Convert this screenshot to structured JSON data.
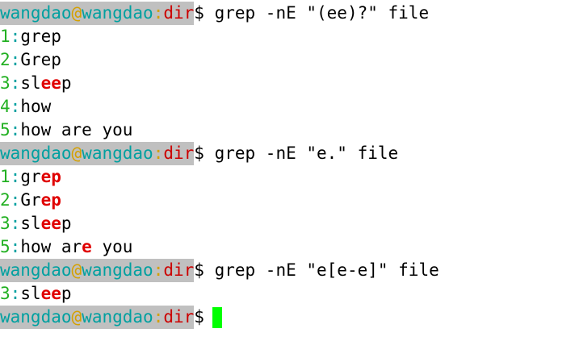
{
  "prompt": {
    "user": "wangdao",
    "at": "@",
    "host": "wangdao",
    "colon": ":",
    "dir": "dir",
    "dollar": "$"
  },
  "colors": {
    "prompt_bg": "#c0c0c0",
    "user_host": "#00a0a0",
    "at_colon": "#d4a000",
    "dir": "#cc0000",
    "line_number": "#22b022",
    "separator": "#00a0a0",
    "match": "#e00000",
    "cursor": "#00ff00"
  },
  "blocks": [
    {
      "command": " grep -nE \"(ee)?\" file",
      "results": [
        {
          "num": "1",
          "sep": ":",
          "pre": "grep",
          "match": "",
          "post": ""
        },
        {
          "num": "2",
          "sep": ":",
          "pre": "Grep",
          "match": "",
          "post": ""
        },
        {
          "num": "3",
          "sep": ":",
          "pre": "sl",
          "match": "ee",
          "post": "p"
        },
        {
          "num": "4",
          "sep": ":",
          "pre": "how",
          "match": "",
          "post": ""
        },
        {
          "num": "5",
          "sep": ":",
          "pre": "how are you",
          "match": "",
          "post": ""
        }
      ]
    },
    {
      "command": " grep -nE \"e.\" file",
      "results": [
        {
          "num": "1",
          "sep": ":",
          "pre": "gr",
          "match": "ep",
          "post": ""
        },
        {
          "num": "2",
          "sep": ":",
          "pre": "Gr",
          "match": "ep",
          "post": ""
        },
        {
          "num": "3",
          "sep": ":",
          "pre": "sl",
          "match": "ee",
          "post": "p"
        },
        {
          "num": "5",
          "sep": ":",
          "pre": "how ar",
          "match": "e ",
          "post": "you"
        }
      ]
    },
    {
      "command": " grep -nE \"e[e-e]\" file",
      "results": [
        {
          "num": "3",
          "sep": ":",
          "pre": "sl",
          "match": "ee",
          "post": "p"
        }
      ]
    }
  ]
}
